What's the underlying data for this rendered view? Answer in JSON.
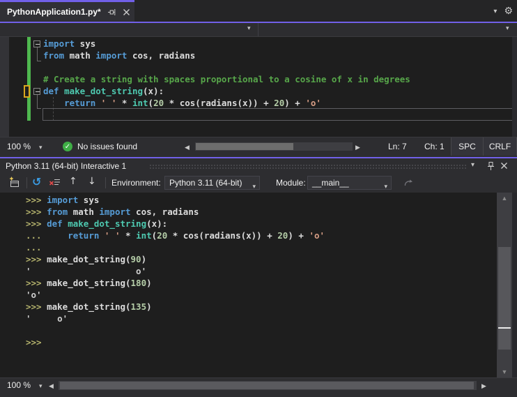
{
  "colors": {
    "accent": "#7160e8",
    "editor_background": "#1e1e1e",
    "panel_background": "#2d2d30",
    "keyword": "#569cd6",
    "function_name": "#4ec9b0",
    "comment": "#57a64a",
    "string": "#d69d85",
    "number": "#b5cea8",
    "prompt": "#b5b36d",
    "plain_text": "#dcdcdc",
    "output_text": "#cfcfcf",
    "track_changes_saved": "#4fb84f",
    "track_changes_unsaved": "#d9a61e",
    "no_issues_check": "#3fae46"
  },
  "icons": {
    "gear": "⚙",
    "dropdown": "▾",
    "check": "✓",
    "reset": "↺",
    "history_up": "↑",
    "history_down": "↓",
    "scroll_left": "◀",
    "scroll_right": "▶",
    "scroll_up": "▲",
    "scroll_down": "▼"
  },
  "tab_bar": {
    "tab_title": "PythonApplication1.py*"
  },
  "editor": {
    "lines": [
      [
        [
          "kw",
          "import"
        ],
        [
          "pl",
          " sys"
        ]
      ],
      [
        [
          "kw",
          "from"
        ],
        [
          "pl",
          " math "
        ],
        [
          "kw",
          "import"
        ],
        [
          "pl",
          " cos, radians"
        ]
      ],
      [],
      [
        [
          "cm",
          "# Create a string with spaces proportional to a cosine of x in degrees"
        ]
      ],
      [
        [
          "kw",
          "def"
        ],
        [
          "pl",
          " "
        ],
        [
          "fn",
          "make_dot_string"
        ],
        [
          "pl",
          "(x):"
        ]
      ],
      [
        [
          "pl",
          "    "
        ],
        [
          "kw",
          "return"
        ],
        [
          "pl",
          " "
        ],
        [
          "st",
          "' '"
        ],
        [
          "pl",
          " * "
        ],
        [
          "fn",
          "int"
        ],
        [
          "pl",
          "("
        ],
        [
          "nu",
          "20"
        ],
        [
          "pl",
          " * cos(radians(x)) + "
        ],
        [
          "nu",
          "20"
        ],
        [
          "pl",
          ") + "
        ],
        [
          "st",
          "'o'"
        ]
      ],
      []
    ],
    "status_bar": {
      "zoom": "100 %",
      "issues": "No issues found",
      "line": "Ln: 7",
      "column": "Ch: 1",
      "indent_mode": "SPC",
      "line_ending": "CRLF"
    }
  },
  "interactive": {
    "title": "Python 3.11 (64-bit) Interactive 1",
    "toolbar": {
      "environment_label": "Environment:",
      "environment_value": "Python 3.11 (64-bit)",
      "module_label": "Module:",
      "module_value": "__main__"
    },
    "lines": [
      [
        [
          "pr",
          ">>> "
        ],
        [
          "kw",
          "import"
        ],
        [
          "pl",
          " sys"
        ]
      ],
      [
        [
          "pr",
          ">>> "
        ],
        [
          "kw",
          "from"
        ],
        [
          "pl",
          " math "
        ],
        [
          "kw",
          "import"
        ],
        [
          "pl",
          " cos, radians"
        ]
      ],
      [
        [
          "pr",
          ">>> "
        ],
        [
          "kw",
          "def"
        ],
        [
          "pl",
          " "
        ],
        [
          "fn",
          "make_dot_string"
        ],
        [
          "pl",
          "(x):"
        ]
      ],
      [
        [
          "pr",
          "... "
        ],
        [
          "pl",
          "    "
        ],
        [
          "kw",
          "return"
        ],
        [
          "pl",
          " "
        ],
        [
          "st",
          "' '"
        ],
        [
          "pl",
          " * "
        ],
        [
          "fn",
          "int"
        ],
        [
          "pl",
          "("
        ],
        [
          "nu",
          "20"
        ],
        [
          "pl",
          " * cos(radians(x)) + "
        ],
        [
          "nu",
          "20"
        ],
        [
          "pl",
          ") + "
        ],
        [
          "st",
          "'o'"
        ]
      ],
      [
        [
          "pr",
          "..."
        ]
      ],
      [
        [
          "pr",
          ">>> "
        ],
        [
          "pl",
          "make_dot_string("
        ],
        [
          "nu",
          "90"
        ],
        [
          "pl",
          ")"
        ]
      ],
      [
        [
          "out",
          "'                    o'"
        ]
      ],
      [
        [
          "pr",
          ">>> "
        ],
        [
          "pl",
          "make_dot_string("
        ],
        [
          "nu",
          "180"
        ],
        [
          "pl",
          ")"
        ]
      ],
      [
        [
          "out",
          "'o'"
        ]
      ],
      [
        [
          "pr",
          ">>> "
        ],
        [
          "pl",
          "make_dot_string("
        ],
        [
          "nu",
          "135"
        ],
        [
          "pl",
          ")"
        ]
      ],
      [
        [
          "out",
          "'     o'"
        ]
      ],
      [],
      [
        [
          "pr",
          ">>>"
        ]
      ]
    ],
    "status_bar": {
      "zoom": "100 %"
    }
  }
}
